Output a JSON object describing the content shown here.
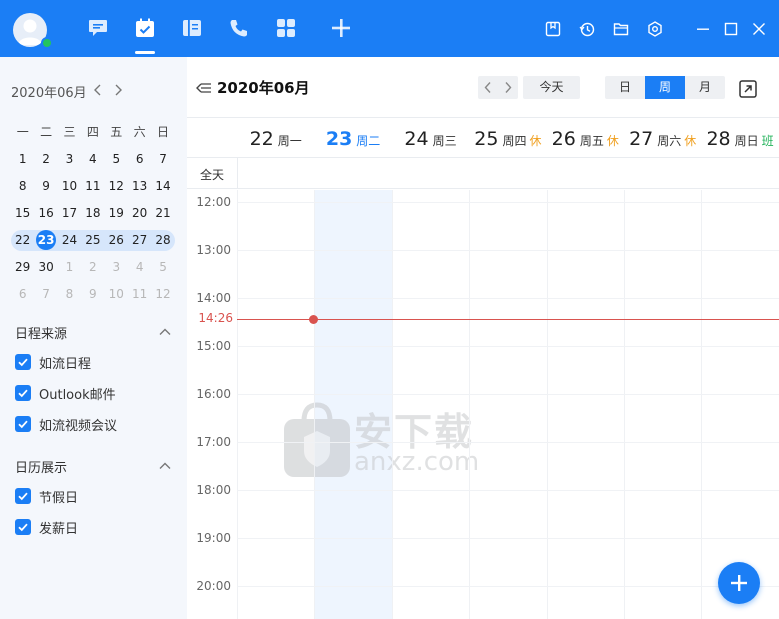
{
  "colors": {
    "accent": "#1b7ef5",
    "now": "#d9534f",
    "holiday": "#f0a020",
    "workday": "#22b35a"
  },
  "topbar": {
    "nav_icons": [
      "chat-icon",
      "calendar-icon",
      "notebook-icon",
      "phone-icon",
      "apps-icon",
      "plus-icon"
    ],
    "active_nav": "calendar-icon",
    "window_icons": [
      "note-icon",
      "history-icon",
      "folder-icon",
      "settings-icon",
      "minimize-icon",
      "maximize-icon",
      "close-icon"
    ]
  },
  "mini_calendar": {
    "title": "2020年06月",
    "weekdays": [
      "一",
      "二",
      "三",
      "四",
      "五",
      "六",
      "日"
    ],
    "weeks": [
      [
        {
          "d": "1"
        },
        {
          "d": "2"
        },
        {
          "d": "3"
        },
        {
          "d": "4"
        },
        {
          "d": "5"
        },
        {
          "d": "6"
        },
        {
          "d": "7"
        }
      ],
      [
        {
          "d": "8"
        },
        {
          "d": "9"
        },
        {
          "d": "10"
        },
        {
          "d": "11"
        },
        {
          "d": "12"
        },
        {
          "d": "13"
        },
        {
          "d": "14"
        }
      ],
      [
        {
          "d": "15"
        },
        {
          "d": "16"
        },
        {
          "d": "17"
        },
        {
          "d": "18"
        },
        {
          "d": "19"
        },
        {
          "d": "20"
        },
        {
          "d": "21"
        }
      ],
      [
        {
          "d": "22"
        },
        {
          "d": "23",
          "today": true
        },
        {
          "d": "24"
        },
        {
          "d": "25"
        },
        {
          "d": "26"
        },
        {
          "d": "27"
        },
        {
          "d": "28"
        }
      ],
      [
        {
          "d": "29"
        },
        {
          "d": "30"
        },
        {
          "d": "1",
          "other": true
        },
        {
          "d": "2",
          "other": true
        },
        {
          "d": "3",
          "other": true
        },
        {
          "d": "4",
          "other": true
        },
        {
          "d": "5",
          "other": true
        }
      ],
      [
        {
          "d": "6",
          "other": true
        },
        {
          "d": "7",
          "other": true
        },
        {
          "d": "8",
          "other": true
        },
        {
          "d": "9",
          "other": true
        },
        {
          "d": "10",
          "other": true
        },
        {
          "d": "11",
          "other": true
        },
        {
          "d": "12",
          "other": true
        }
      ]
    ],
    "selected_week": 3
  },
  "sources": {
    "title": "日程来源",
    "items": [
      "如流日程",
      "Outlook邮件",
      "如流视频会议"
    ]
  },
  "display": {
    "title": "日历展示",
    "items": [
      "节假日",
      "发薪日"
    ]
  },
  "main": {
    "title": "2020年06月",
    "today_label": "今天",
    "views": [
      "日",
      "周",
      "月"
    ],
    "active_view": "周",
    "allday_label": "全天",
    "days": [
      {
        "num": "22",
        "weekday": "周一",
        "tag": ""
      },
      {
        "num": "23",
        "weekday": "周二",
        "tag": "",
        "current": true
      },
      {
        "num": "24",
        "weekday": "周三",
        "tag": ""
      },
      {
        "num": "25",
        "weekday": "周四",
        "tag": "休",
        "tag_type": "holiday"
      },
      {
        "num": "26",
        "weekday": "周五",
        "tag": "休",
        "tag_type": "holiday"
      },
      {
        "num": "27",
        "weekday": "周六",
        "tag": "休",
        "tag_type": "holiday"
      },
      {
        "num": "28",
        "weekday": "周日",
        "tag": "班",
        "tag_type": "workday"
      }
    ],
    "hours": [
      "12:00",
      "13:00",
      "14:00",
      "15:00",
      "16:00",
      "17:00",
      "18:00",
      "19:00",
      "20:00"
    ],
    "now_label": "14:26",
    "watermark_main": "安下载",
    "watermark_sub": "anxz.com"
  }
}
